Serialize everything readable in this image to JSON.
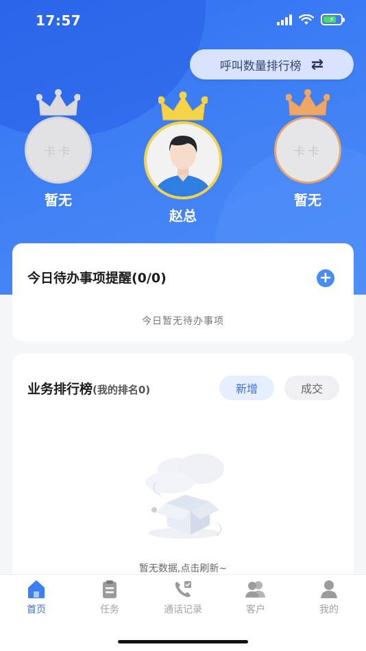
{
  "status_bar": {
    "time": "17:57"
  },
  "header": {
    "rank_toggle_label": "呼叫数量排行榜"
  },
  "podium": {
    "first": {
      "name": "赵总"
    },
    "second": {
      "name": "暂无",
      "placeholder": "卡卡"
    },
    "third": {
      "name": "暂无",
      "placeholder": "卡卡"
    }
  },
  "todo": {
    "title": "今日待办事项提醒(0/0)",
    "empty_text": "今日暂无待办事项"
  },
  "business_rank": {
    "title": "业务排行榜",
    "subtitle": "(我的排名0)",
    "tabs": [
      "新增",
      "成交"
    ],
    "empty_text": "暂无数据,点击刷新~"
  },
  "tabbar": {
    "items": [
      {
        "label": "首页",
        "icon": "home-icon",
        "active": true
      },
      {
        "label": "任务",
        "icon": "clipboard-icon",
        "active": false
      },
      {
        "label": "通话记录",
        "icon": "phone-icon",
        "active": false
      },
      {
        "label": "客户",
        "icon": "users-icon",
        "active": false
      },
      {
        "label": "我的",
        "icon": "user-icon",
        "active": false
      }
    ]
  },
  "colors": {
    "primary": "#3d6fd8",
    "hero_blue": "#3f7ff5",
    "gold": "#f4d24e",
    "bronze": "#e7a66a",
    "silver": "#d4d4d6"
  }
}
